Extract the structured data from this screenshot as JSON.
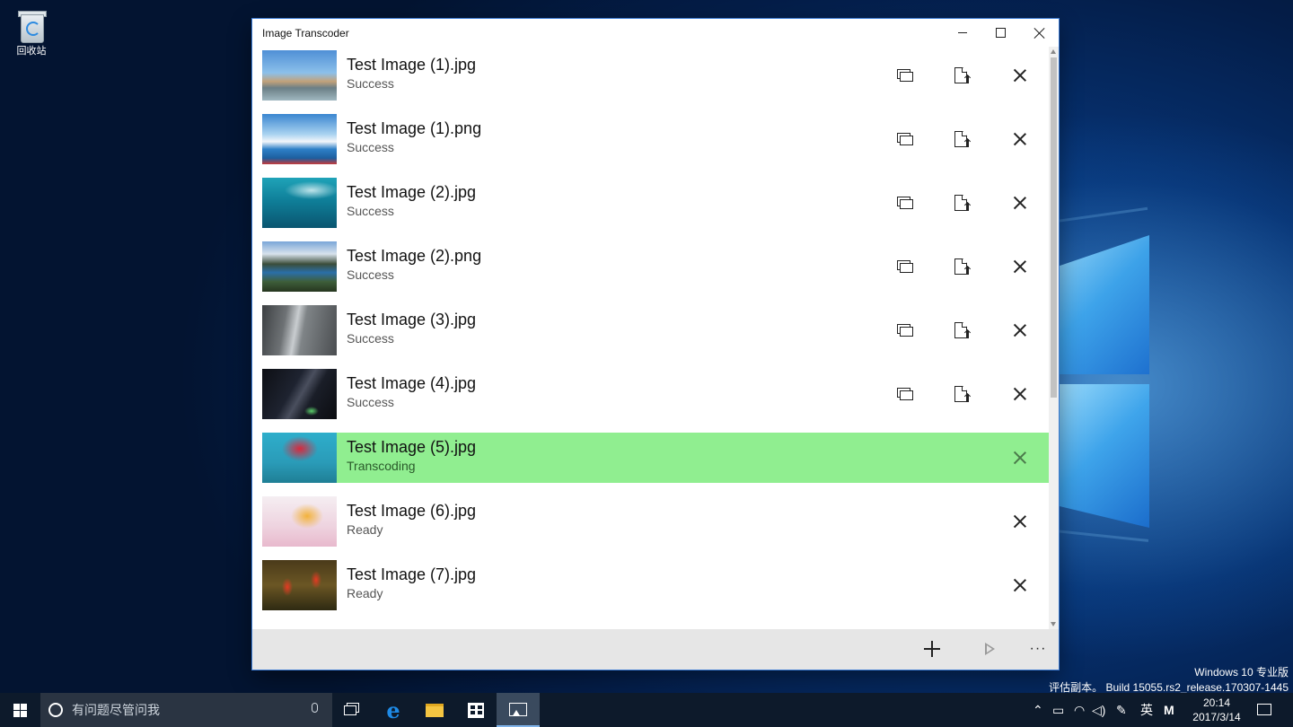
{
  "desktop": {
    "recycle_bin_label": "回收站",
    "watermark": {
      "line1": "Windows 10 专业版",
      "line2": "评估副本。 Build 15055.rs2_release.170307-1445"
    }
  },
  "window": {
    "title": "Image Transcoder",
    "controls": [
      "minimize-icon",
      "maximize-icon",
      "close-icon"
    ]
  },
  "items": [
    {
      "name": "Test Image (1).jpg",
      "status": "Success",
      "actions": [
        "compare",
        "open-file",
        "remove"
      ]
    },
    {
      "name": "Test Image (1).png",
      "status": "Success",
      "actions": [
        "compare",
        "open-file",
        "remove"
      ]
    },
    {
      "name": "Test Image (2).jpg",
      "status": "Success",
      "actions": [
        "compare",
        "open-file",
        "remove"
      ]
    },
    {
      "name": "Test Image (2).png",
      "status": "Success",
      "actions": [
        "compare",
        "open-file",
        "remove"
      ]
    },
    {
      "name": "Test Image (3).jpg",
      "status": "Success",
      "actions": [
        "compare",
        "open-file",
        "remove"
      ]
    },
    {
      "name": "Test Image (4).jpg",
      "status": "Success",
      "actions": [
        "compare",
        "open-file",
        "remove"
      ]
    },
    {
      "name": "Test Image (5).jpg",
      "status": "Transcoding",
      "actions": [
        "remove"
      ]
    },
    {
      "name": "Test Image (6).jpg",
      "status": "Ready",
      "actions": [
        "remove"
      ]
    },
    {
      "name": "Test Image (7).jpg",
      "status": "Ready",
      "actions": [
        "remove"
      ]
    }
  ],
  "colors": {
    "active_row": "#90ee90",
    "command_bar": "#e6e6e6",
    "taskbar": "#0d1a2b",
    "edge_blue": "#1e8ae6"
  },
  "command_bar": {
    "icons": [
      "plus-icon",
      "play-icon",
      "more-icon"
    ],
    "more_glyph": "···"
  },
  "taskbar": {
    "search_placeholder": "有问题尽管问我",
    "pinned_icons": [
      "task-view-icon",
      "edge-icon",
      "file-explorer-icon",
      "store-icon",
      "image-transcoder-icon"
    ],
    "tray": {
      "ime_label": "英",
      "ime_mode": "M",
      "time": "20:14",
      "date": "2017/3/14"
    }
  }
}
